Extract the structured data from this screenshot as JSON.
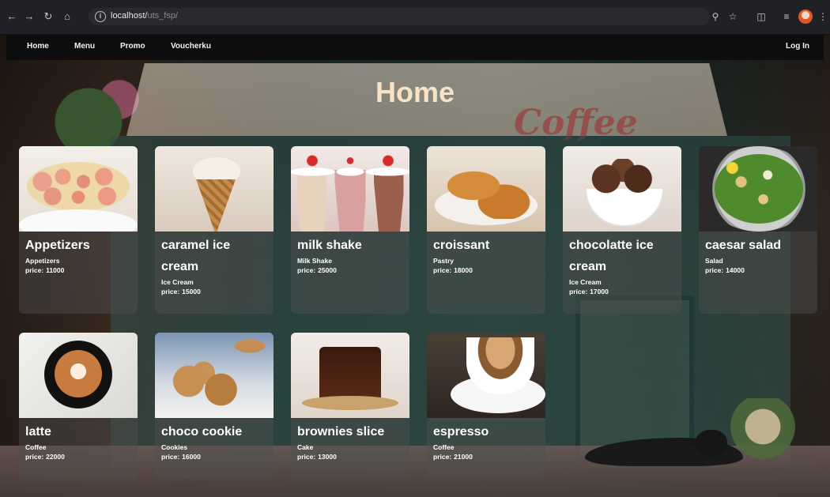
{
  "browser": {
    "url_host": "localhost/",
    "url_path": "uts_fsp/"
  },
  "navbar": {
    "links": [
      {
        "label": "Home"
      },
      {
        "label": "Menu"
      },
      {
        "label": "Promo"
      },
      {
        "label": "Voucherku"
      }
    ],
    "login_label": "Log In"
  },
  "page": {
    "title": "Home"
  },
  "price_label": "price:",
  "products": [
    {
      "name": "Appetizers",
      "category": "Appetizers",
      "price": "11000"
    },
    {
      "name": "caramel ice cream",
      "category": "Ice Cream",
      "price": "15000"
    },
    {
      "name": "milk shake",
      "category": "Milk Shake",
      "price": "25000"
    },
    {
      "name": "croissant",
      "category": "Pastry",
      "price": "18000"
    },
    {
      "name": "chocolatte ice cream",
      "category": "Ice Cream",
      "price": "17000"
    },
    {
      "name": "caesar salad",
      "category": "Salad",
      "price": "14000"
    },
    {
      "name": "latte",
      "category": "Coffee",
      "price": "22000"
    },
    {
      "name": "choco cookie",
      "category": "Cookies",
      "price": "16000"
    },
    {
      "name": "brownies slice",
      "category": "Cake",
      "price": "13000"
    },
    {
      "name": "espresso",
      "category": "Coffee",
      "price": "21000"
    }
  ],
  "background_sign": "Coffee",
  "colors": {
    "title": "#f7e4c8",
    "navbar_bg": "#0d0d0d",
    "card_bg": "rgba(80,80,80,0.45)"
  },
  "icons": {
    "back": "arrow-left-icon",
    "forward": "arrow-right-icon",
    "reload": "reload-icon",
    "home": "home-icon",
    "site_info": "info-icon",
    "zoom": "zoom-icon",
    "bookmark": "star-icon",
    "extensions": "puzzle-icon",
    "media": "media-icon",
    "menu": "kebab-menu-icon"
  }
}
